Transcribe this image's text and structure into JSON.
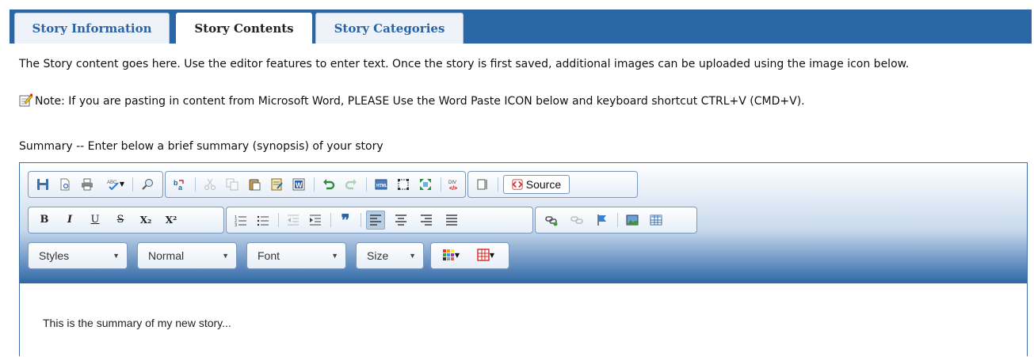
{
  "tabs": [
    {
      "label": "Story Information",
      "active": false
    },
    {
      "label": "Story Contents",
      "active": true
    },
    {
      "label": "Story Categories",
      "active": false
    }
  ],
  "intro_text": "The Story content goes here. Use the editor features to enter text. Once the story is first saved, additional images can be uploaded using the image icon below.",
  "note_text": "Note: If you are pasting in content from Microsoft Word, PLEASE Use the Word Paste ICON below and keyboard shortcut CTRL+V (CMD+V).",
  "summary_label": "Summary -- Enter below a brief summary (synopsis) of your story",
  "editor": {
    "source_label": "Source",
    "format_buttons": {
      "bold": "B",
      "italic": "I",
      "underline": "U",
      "strike": "S",
      "subscript": "X₂",
      "superscript": "X²"
    },
    "combos": {
      "styles": "Styles",
      "format": "Normal",
      "font": "Font",
      "size": "Size"
    },
    "content": "This is the summary of my new story...",
    "colors": {
      "accent": "#2a67a4",
      "toolbar_border": "#7a97bd"
    }
  }
}
